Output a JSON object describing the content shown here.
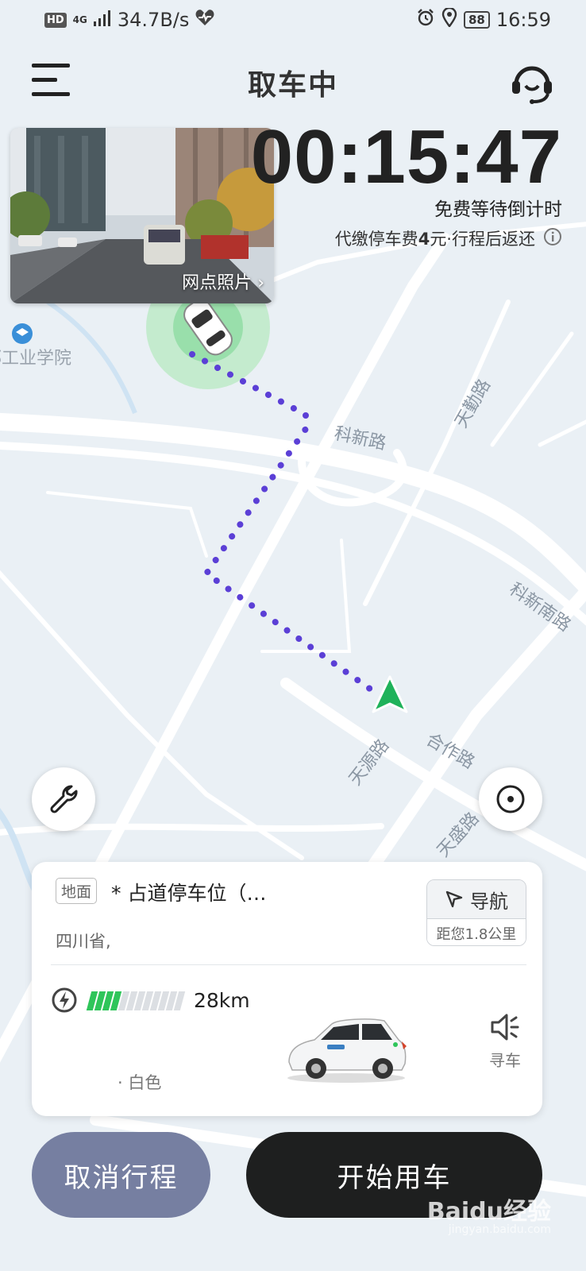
{
  "status_bar": {
    "hd": "HD",
    "network": "4G",
    "speed": "34.7B/s",
    "battery": "88",
    "time": "16:59"
  },
  "header": {
    "title": "取车中"
  },
  "photo_card": {
    "label": "网点照片"
  },
  "timer": {
    "value": "00:15:47",
    "note": "免费等待倒计时"
  },
  "fee": {
    "prefix": "代缴停车费",
    "amount": "4",
    "suffix": "元·行程后返还"
  },
  "map": {
    "road_labels": {
      "kexin": "科新路",
      "kexin_south": "科新南路",
      "tianqin": "天勤路",
      "tianyuan": "天源路",
      "hezuo": "合作路",
      "tiansheng": "天盛路"
    },
    "poi_label": "郡工业学院"
  },
  "station": {
    "tag": "地面",
    "name": "*                        占道停车位（…",
    "address": "四川省,"
  },
  "navigation": {
    "label": "导航",
    "distance": "距您1.8公里"
  },
  "vehicle": {
    "battery_level": 0.35,
    "range": "28km",
    "color": "· 白色",
    "find_label": "寻车"
  },
  "actions": {
    "cancel": "取消行程",
    "start": "开始用车"
  },
  "watermark": {
    "brand": "Baidu经验",
    "url": "jingyan.baidu.com"
  },
  "colors": {
    "route": "#5b3fd6",
    "user_arrow": "#1fb25a",
    "cancel_button": "#767fa1",
    "start_button": "#1e1f1f",
    "battery_on": "#2fc55a"
  }
}
